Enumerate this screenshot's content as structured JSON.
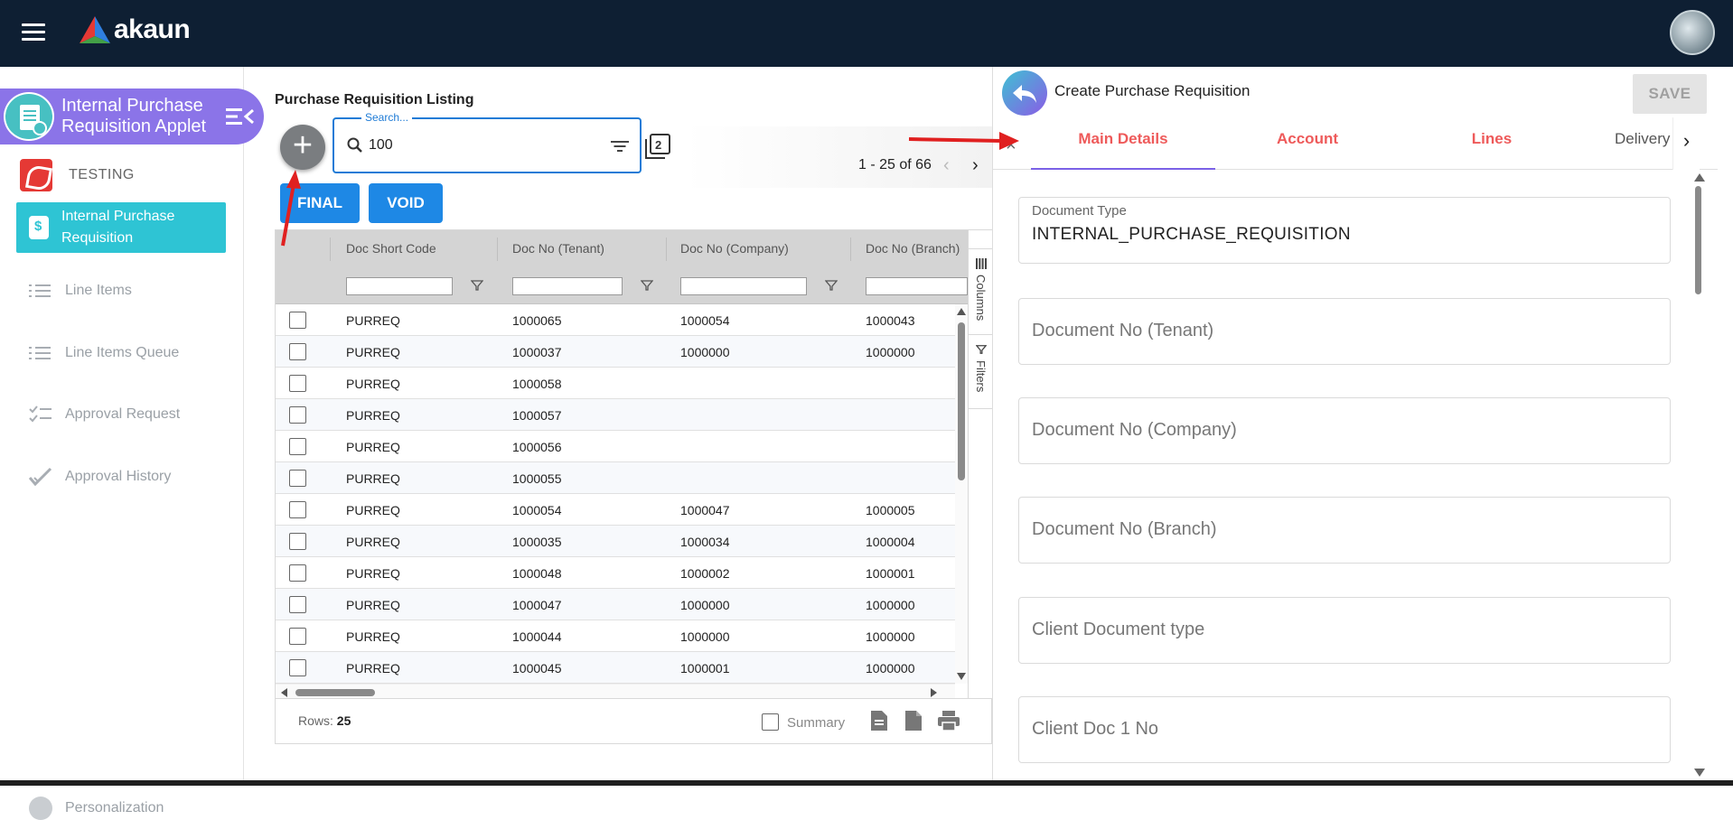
{
  "topbar": {
    "brand": "akaun"
  },
  "sidebar": {
    "applet_title_line1": "Internal Purchase",
    "applet_title_line2": "Requisition Applet",
    "group_label": "TESTING",
    "items": [
      {
        "label": "Internal Purchase Requisition",
        "icon": "dollar-doc-icon",
        "active": true
      },
      {
        "label": "Line Items",
        "icon": "list-icon",
        "active": false
      },
      {
        "label": "Line Items Queue",
        "icon": "list-icon",
        "active": false
      },
      {
        "label": "Approval Request",
        "icon": "checklist-icon",
        "active": false
      },
      {
        "label": "Approval History",
        "icon": "double-check-icon",
        "active": false
      }
    ],
    "personalization": "Personalization"
  },
  "listing": {
    "title": "Purchase Requisition Listing",
    "search": {
      "legend": "Search...",
      "value": "100"
    },
    "pager": {
      "text": "1 - 25 of 66",
      "prev": "‹",
      "next": "›"
    },
    "buttons": {
      "final": "FINAL",
      "void": "VOID"
    },
    "columns": [
      "Doc Short Code",
      "Doc No (Tenant)",
      "Doc No (Company)",
      "Doc No (Branch)"
    ],
    "rows": [
      [
        "PURREQ",
        "1000065",
        "1000054",
        "1000043"
      ],
      [
        "PURREQ",
        "1000037",
        "1000000",
        "1000000"
      ],
      [
        "PURREQ",
        "1000058",
        "",
        ""
      ],
      [
        "PURREQ",
        "1000057",
        "",
        ""
      ],
      [
        "PURREQ",
        "1000056",
        "",
        ""
      ],
      [
        "PURREQ",
        "1000055",
        "",
        ""
      ],
      [
        "PURREQ",
        "1000054",
        "1000047",
        "1000005"
      ],
      [
        "PURREQ",
        "1000035",
        "1000034",
        "1000004"
      ],
      [
        "PURREQ",
        "1000048",
        "1000002",
        "1000001"
      ],
      [
        "PURREQ",
        "1000047",
        "1000000",
        "1000000"
      ],
      [
        "PURREQ",
        "1000044",
        "1000000",
        "1000000"
      ],
      [
        "PURREQ",
        "1000045",
        "1000001",
        "1000000"
      ]
    ],
    "side_tools": {
      "columns": "Columns",
      "filters": "Filters"
    },
    "footer": {
      "rows_label": "Rows:",
      "rows_value": "25",
      "summary": "Summary"
    }
  },
  "detail": {
    "title": "Create Purchase Requisition",
    "save": "SAVE",
    "tabs": [
      {
        "label": "Main Details",
        "active": true
      },
      {
        "label": "Account",
        "active": false
      },
      {
        "label": "Lines",
        "active": false
      },
      {
        "label": "Delivery",
        "active": false
      }
    ],
    "fields": [
      {
        "label": "Document Type",
        "value": "INTERNAL_PURCHASE_REQUISITION"
      },
      {
        "placeholder": "Document No (Tenant)"
      },
      {
        "placeholder": "Document No (Company)"
      },
      {
        "placeholder": "Document No (Branch)"
      },
      {
        "placeholder": "Client Document type"
      },
      {
        "placeholder": "Client Doc 1 No"
      }
    ]
  },
  "colors": {
    "topbar": "#0e1f33",
    "applet_header": "#8b74e8",
    "active_nav": "#2ec4d4",
    "primary_button": "#1e88e5",
    "tab_text": "#ee5a5a",
    "tab_indicator": "#7b61e6",
    "annotation_arrow": "#e02020"
  }
}
